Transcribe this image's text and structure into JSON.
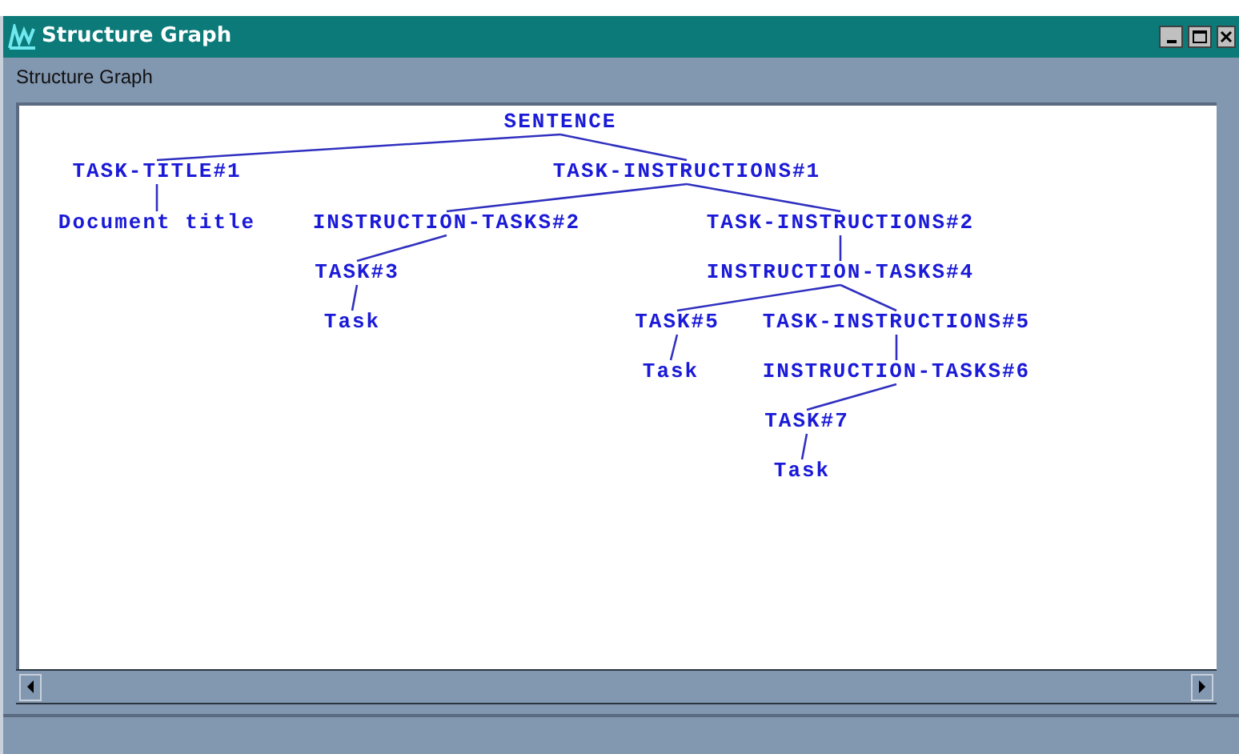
{
  "window": {
    "title": "Structure Graph"
  },
  "menu": [
    "Structure Graph"
  ],
  "tree": {
    "label": "SENTENCE",
    "children": [
      {
        "label": "TASK-TITLE#1",
        "children": [
          {
            "label": "Document title"
          }
        ]
      },
      {
        "label": "TASK-INSTRUCTIONS#1",
        "children": [
          {
            "label": "INSTRUCTION-TASKS#2",
            "children": [
              {
                "label": "TASK#3",
                "children": [
                  {
                    "label": "Task"
                  }
                ]
              }
            ]
          },
          {
            "label": "TASK-INSTRUCTIONS#2",
            "children": [
              {
                "label": "INSTRUCTION-TASKS#4",
                "children": [
                  {
                    "label": "TASK#5",
                    "children": [
                      {
                        "label": "Task"
                      }
                    ]
                  },
                  {
                    "label": "TASK-INSTRUCTIONS#5",
                    "children": [
                      {
                        "label": "INSTRUCTION-TASKS#6",
                        "children": [
                          {
                            "label": "TASK#7",
                            "children": [
                              {
                                "label": "Task"
                              }
                            ]
                          }
                        ]
                      }
                    ]
                  }
                ]
              }
            ]
          }
        ]
      }
    ]
  }
}
